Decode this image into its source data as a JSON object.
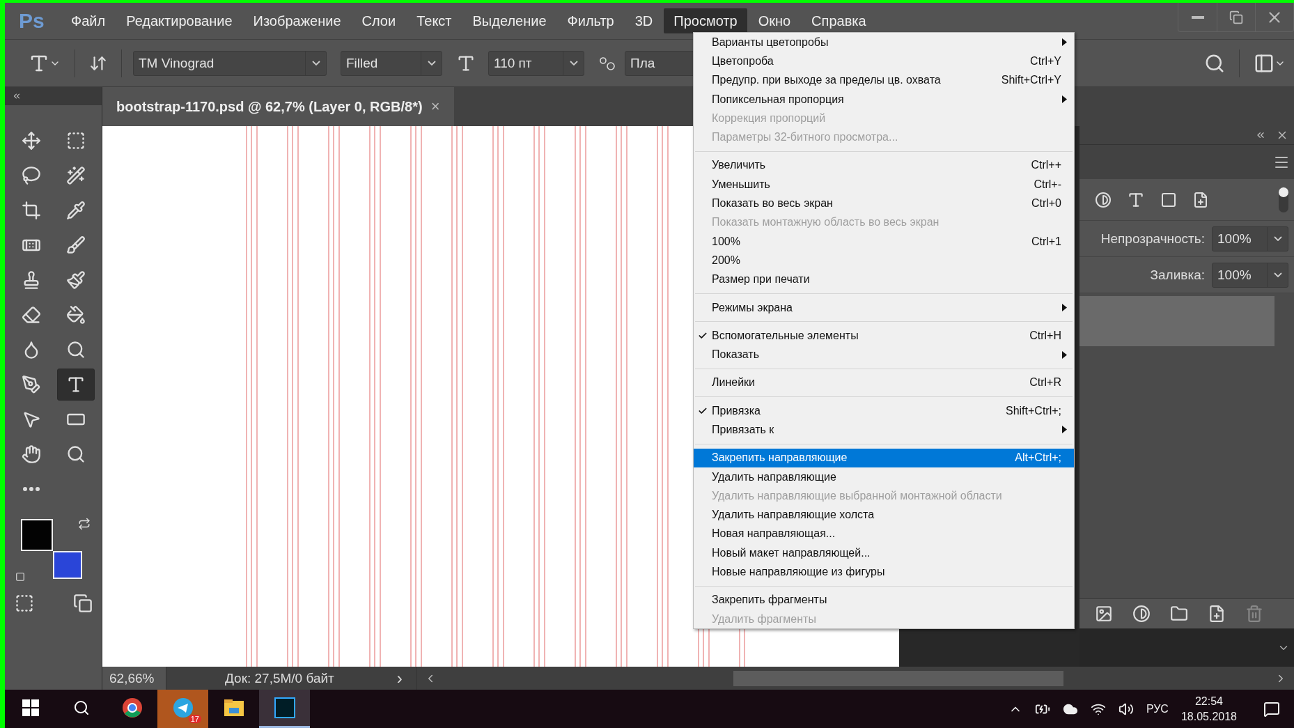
{
  "app_logo": "Ps",
  "menu_bar": [
    {
      "label": "Файл",
      "selected": false
    },
    {
      "label": "Редактирование",
      "selected": false
    },
    {
      "label": "Изображение",
      "selected": false
    },
    {
      "label": "Слои",
      "selected": false
    },
    {
      "label": "Текст",
      "selected": false
    },
    {
      "label": "Выделение",
      "selected": false
    },
    {
      "label": "Фильтр",
      "selected": false
    },
    {
      "label": "3D",
      "selected": false
    },
    {
      "label": "Просмотр",
      "selected": true
    },
    {
      "label": "Окно",
      "selected": false
    },
    {
      "label": "Справка",
      "selected": false
    }
  ],
  "options_bar": {
    "font_family": "TM Vinograd",
    "font_style": "Filled",
    "font_size": "110 пт",
    "antialiasing": "Пла"
  },
  "document_tab": {
    "title": "bootstrap-1170.psd @ 62,7% (Layer 0, RGB/8*)",
    "close": "×"
  },
  "tools": [
    {
      "selected": false
    },
    {
      "selected": false
    },
    {
      "selected": false
    },
    {
      "selected": false
    },
    {
      "selected": false
    },
    {
      "selected": false
    },
    {
      "selected": false
    },
    {
      "selected": false
    },
    {
      "selected": false
    },
    {
      "selected": false
    },
    {
      "selected": false
    },
    {
      "selected": false
    },
    {
      "selected": false
    },
    {
      "selected": false
    },
    {
      "selected": false
    },
    {
      "selected": true
    },
    {
      "selected": false
    },
    {
      "selected": false
    },
    {
      "selected": false
    },
    {
      "selected": false
    },
    {
      "selected": false
    }
  ],
  "swatches": [
    {
      "color": "#030303"
    },
    {
      "color": "#2a45d8"
    }
  ],
  "view_menu": {
    "groups": [
      [
        {
          "label": "Варианты цветопробы",
          "submenu": true,
          "checked": false,
          "disabled": false,
          "selected": false
        },
        {
          "label": "Цветопроба",
          "shortcut": "Ctrl+Y",
          "submenu": false,
          "checked": false,
          "disabled": false,
          "selected": false
        },
        {
          "label": "Предупр. при выходе за пределы цв. охвата",
          "shortcut": "Shift+Ctrl+Y",
          "submenu": false,
          "checked": false,
          "disabled": false,
          "selected": false
        },
        {
          "label": "Попиксельная пропорция",
          "submenu": true,
          "checked": false,
          "disabled": false,
          "selected": false
        },
        {
          "label": "Коррекция пропорций",
          "submenu": false,
          "checked": false,
          "disabled": true,
          "selected": false
        },
        {
          "label": "Параметры 32-битного просмотра...",
          "submenu": false,
          "checked": false,
          "disabled": true,
          "selected": false
        }
      ],
      [
        {
          "label": "Увеличить",
          "shortcut": "Ctrl++",
          "submenu": false,
          "checked": false,
          "disabled": false,
          "selected": false
        },
        {
          "label": "Уменьшить",
          "shortcut": "Ctrl+-",
          "submenu": false,
          "checked": false,
          "disabled": false,
          "selected": false
        },
        {
          "label": "Показать во весь экран",
          "shortcut": "Ctrl+0",
          "submenu": false,
          "checked": false,
          "disabled": false,
          "selected": false
        },
        {
          "label": "Показать монтажную область во весь экран",
          "submenu": false,
          "checked": false,
          "disabled": true,
          "selected": false
        },
        {
          "label": "100%",
          "shortcut": "Ctrl+1",
          "submenu": false,
          "checked": false,
          "disabled": false,
          "selected": false
        },
        {
          "label": "200%",
          "submenu": false,
          "checked": false,
          "disabled": false,
          "selected": false
        },
        {
          "label": "Размер при печати",
          "submenu": false,
          "checked": false,
          "disabled": false,
          "selected": false
        }
      ],
      [
        {
          "label": "Режимы экрана",
          "submenu": true,
          "checked": false,
          "disabled": false,
          "selected": false
        }
      ],
      [
        {
          "label": "Вспомогательные элементы",
          "shortcut": "Ctrl+H",
          "submenu": false,
          "checked": true,
          "disabled": false,
          "selected": false
        },
        {
          "label": "Показать",
          "submenu": true,
          "checked": false,
          "disabled": false,
          "selected": false
        }
      ],
      [
        {
          "label": "Линейки",
          "shortcut": "Ctrl+R",
          "submenu": false,
          "checked": false,
          "disabled": false,
          "selected": false
        }
      ],
      [
        {
          "label": "Привязка",
          "shortcut": "Shift+Ctrl+;",
          "submenu": false,
          "checked": true,
          "disabled": false,
          "selected": false
        },
        {
          "label": "Привязать к",
          "submenu": true,
          "checked": false,
          "disabled": false,
          "selected": false
        }
      ],
      [
        {
          "label": "Закрепить направляющие",
          "shortcut": "Alt+Ctrl+;",
          "submenu": false,
          "checked": false,
          "disabled": false,
          "selected": true
        },
        {
          "label": "Удалить направляющие",
          "submenu": false,
          "checked": false,
          "disabled": false,
          "selected": false
        },
        {
          "label": "Удалить направляющие выбранной монтажной области",
          "submenu": false,
          "checked": false,
          "disabled": true,
          "selected": false
        },
        {
          "label": "Удалить направляющие холста",
          "submenu": false,
          "checked": false,
          "disabled": false,
          "selected": false
        },
        {
          "label": "Новая направляющая...",
          "submenu": false,
          "checked": false,
          "disabled": false,
          "selected": false
        },
        {
          "label": "Новый макет направляющей...",
          "submenu": false,
          "checked": false,
          "disabled": false,
          "selected": false
        },
        {
          "label": "Новые направляющие из фигуры",
          "submenu": false,
          "checked": false,
          "disabled": false,
          "selected": false
        }
      ],
      [
        {
          "label": "Закрепить фрагменты",
          "submenu": false,
          "checked": false,
          "disabled": false,
          "selected": false
        },
        {
          "label": "Удалить фрагменты",
          "submenu": false,
          "checked": false,
          "disabled": true,
          "selected": false
        }
      ]
    ]
  },
  "layers_panel": {
    "opacity_label": "Непрозрачность:",
    "opacity_value": "100%",
    "fill_label": "Заливка:",
    "fill_value": "100%",
    "layers": [
      {
        "selected": true
      }
    ]
  },
  "status_bar": {
    "zoom": "62,66%",
    "doc_info": "Док: 27,5М/0 байт",
    "arrow": "›"
  },
  "taskbar": {
    "apps": [
      {
        "selected": false,
        "attention": false
      },
      {
        "selected": false,
        "attention": true,
        "badge": "17"
      },
      {
        "selected": false,
        "attention": false
      },
      {
        "selected": true,
        "attention": false
      }
    ],
    "language": "РУС",
    "time": "22:54",
    "date": "18.05.2018"
  }
}
